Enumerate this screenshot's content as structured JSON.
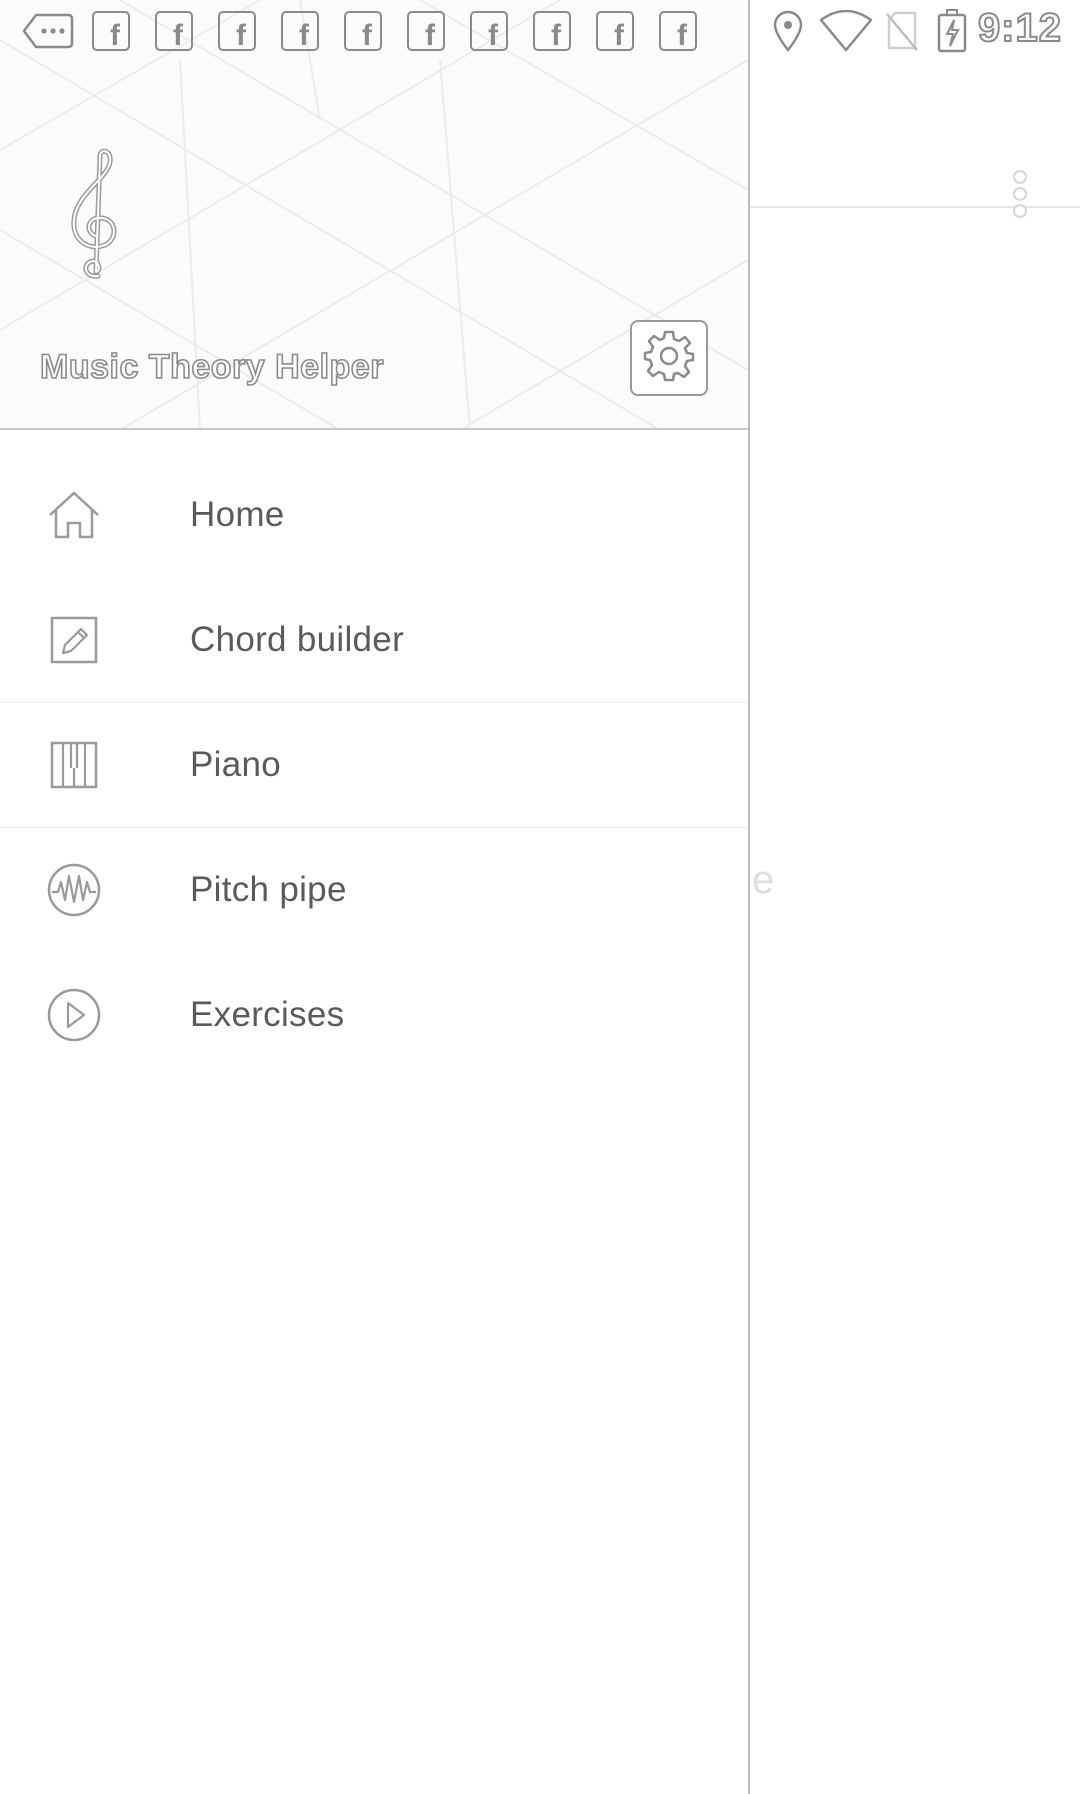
{
  "status_bar": {
    "time": "9:12",
    "notification_icons": [
      "more-icon",
      "facebook-icon",
      "facebook-icon",
      "facebook-icon",
      "facebook-icon",
      "facebook-icon",
      "facebook-icon",
      "facebook-icon",
      "facebook-icon",
      "facebook-icon",
      "facebook-icon"
    ],
    "system_icons": [
      "location-icon",
      "wifi-icon",
      "no-sim-icon",
      "battery-charging-icon"
    ],
    "facebook_glyph": "f"
  },
  "drawer": {
    "app_name": "Music Theory Helper",
    "logo_icon": "treble-clef-icon",
    "settings_icon": "gear-icon",
    "menu_items": [
      {
        "label": "Home",
        "icon": "home-icon"
      },
      {
        "label": "Chord builder",
        "icon": "pencil-icon"
      },
      {
        "label": "Piano",
        "icon": "piano-icon"
      },
      {
        "label": "Pitch pipe",
        "icon": "waveform-icon"
      },
      {
        "label": "Exercises",
        "icon": "play-icon"
      }
    ]
  },
  "background": {
    "overflow_icon": "overflow-menu-icon",
    "partial_text": "e"
  },
  "colors": {
    "drawer_bg": "#ffffff",
    "header_bg": "#fbfbfb",
    "text": "#5a5a5a",
    "icon_stroke": "#9a9a9a"
  }
}
